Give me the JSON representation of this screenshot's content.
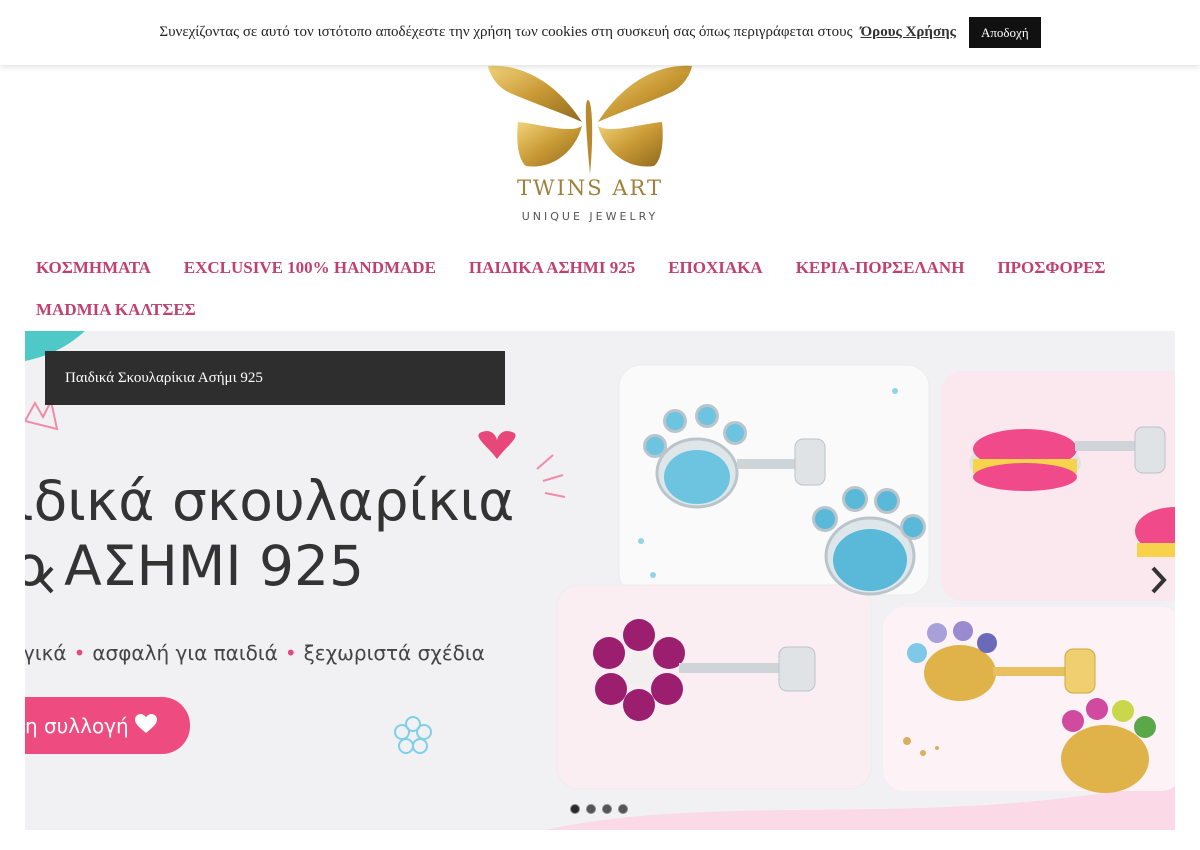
{
  "cookie_bar": {
    "text": "Συνεχίζοντας σε αυτό τον ιστότοπο αποδέχεστε την χρήση των cookies στη συσκευή σας όπως περιγράφεται στους",
    "link_label": "Όρους Χρήσης",
    "accept_label": "Αποδοχή"
  },
  "logo": {
    "title": "TWINS ART",
    "subtitle": "UNIQUE  JEWELRY",
    "color": "#c9a24a"
  },
  "nav": {
    "row1": [
      "ΚΟΣΜΗΜΑΤΑ",
      "EXCLUSIVE 100% HANDMADE",
      "ΠΑΙΔΙΚΑ ΑΣΗΜΙ 925",
      "ΕΠΟΧΙΑΚΑ",
      "ΚΕΡΙΑ-ΠΟΡΣΕΛΑΝΗ",
      "ΠΡΟΣΦΟΡΕΣ"
    ],
    "row2": [
      "MADMIA ΚΑΛΤΣΕΣ"
    ],
    "color": "#c2406e"
  },
  "slider": {
    "caption": "Παιδικά Σκουλαρίκια Ασήμι 925",
    "headline_line1": "ιδικά σκουλαρίκια",
    "headline_line2": "ο ΑΣΗΜΙ 925",
    "features": [
      "γικά",
      "ασφαλή για παιδιά",
      "ξεχωριστά σχέδια"
    ],
    "cta_label": "η συλλογή",
    "slide_count": 4,
    "active_index": 0,
    "accent_color": "#ee4b80"
  },
  "icons": {
    "prev": "chevron-left-icon",
    "next": "chevron-right-icon",
    "heart": "heart-icon"
  }
}
